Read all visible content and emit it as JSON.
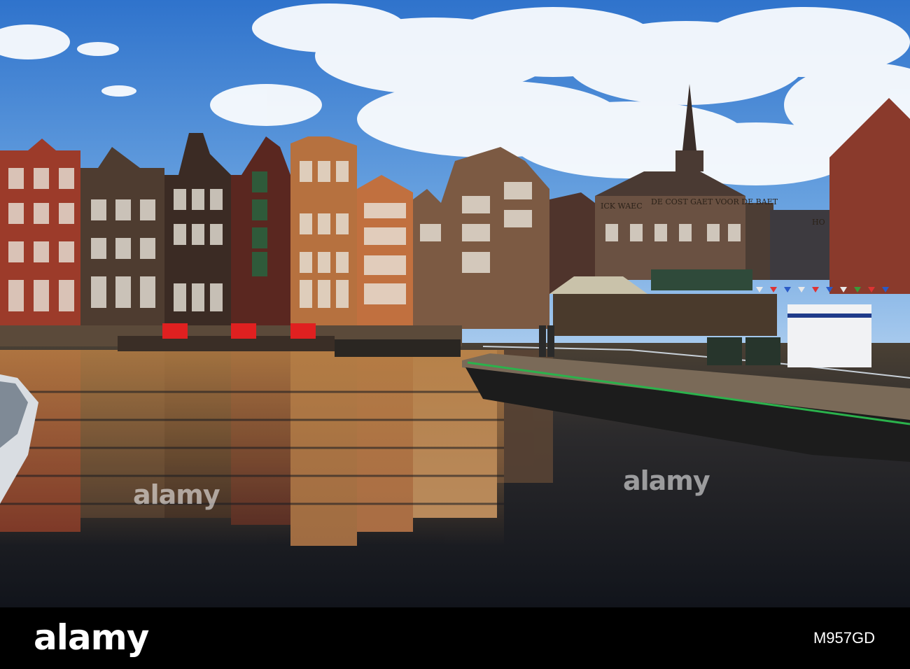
{
  "photo": {
    "description_free": true,
    "signs": {
      "left": "ICK WAEC",
      "right": "DE COST GAET VOOR DE BAET",
      "hotel": "HO"
    }
  },
  "footer": {
    "logo_text": "alamy",
    "image_id": "M957GD"
  },
  "watermark": {
    "text": "alamy"
  },
  "colors": {
    "sky": "#3d7fd0",
    "water": "#1e2430",
    "footer": "#000000"
  }
}
